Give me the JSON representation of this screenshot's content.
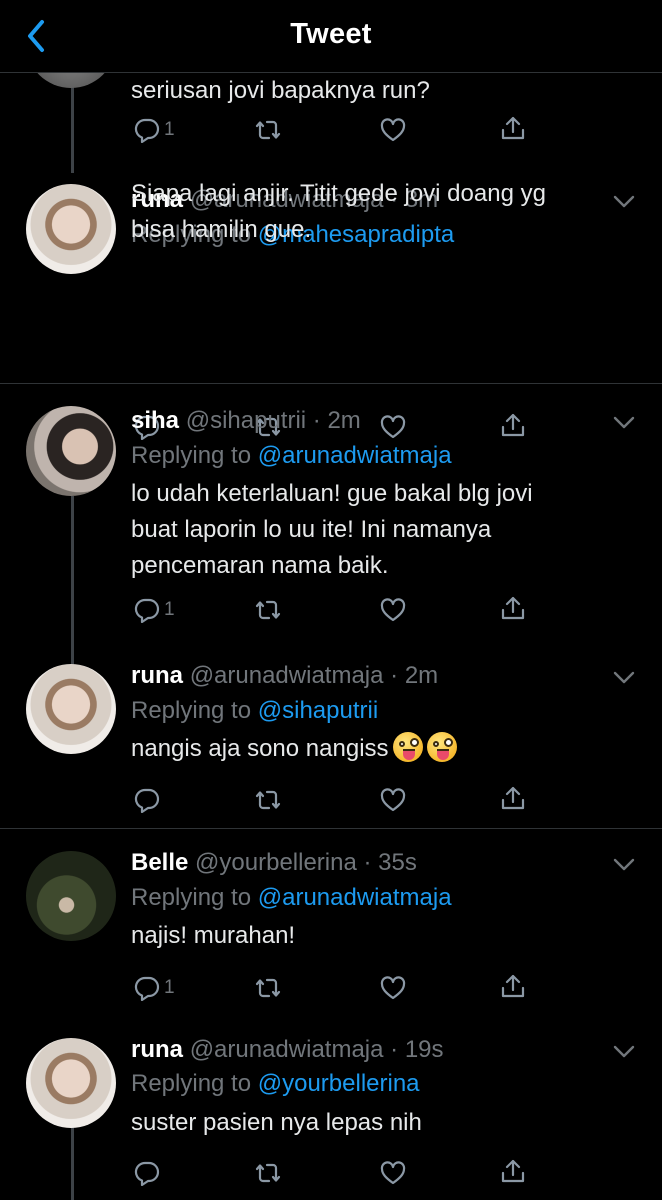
{
  "header": {
    "title": "Tweet"
  },
  "colors": {
    "accent": "#1d9bf0",
    "muted": "#71767b",
    "background": "#000000"
  },
  "tweets": [
    {
      "text": "seriusan jovi bapaknya run?",
      "replies": "1"
    },
    {
      "name": "runa",
      "handle": "@arunadwiatmaja",
      "time": "3m",
      "replying_label": "Replying to",
      "replying_to": "@mahesapradipta",
      "text_lines": [
        "Siapa lagi anjir. Titit gede jovi doang yg",
        "bisa hamilin gue."
      ],
      "replies": ""
    },
    {
      "name": "siha",
      "handle": "@sihaputrii",
      "time": "2m",
      "replying_label": "Replying to",
      "replying_to": "@arunadwiatmaja",
      "text_lines": [
        "lo udah keterlaluan! gue bakal blg jovi",
        "buat laporin lo uu ite! Ini namanya",
        "pencemaran nama baik."
      ],
      "replies": "1"
    },
    {
      "name": "runa",
      "handle": "@arunadwiatmaja",
      "time": "2m",
      "replying_label": "Replying to",
      "replying_to": "@sihaputrii",
      "text": "nangis aja sono nangiss",
      "emojis": [
        "zany-face-emoji",
        "zany-face-emoji"
      ],
      "replies": ""
    },
    {
      "name": "Belle",
      "handle": "@yourbellerina",
      "time": "35s",
      "replying_label": "Replying to",
      "replying_to": "@arunadwiatmaja",
      "text": "najis! murahan!",
      "replies": "1"
    },
    {
      "name": "runa",
      "handle": "@arunadwiatmaja",
      "time": "19s",
      "replying_label": "Replying to",
      "replying_to": "@yourbellerina",
      "text": "suster pasien nya lepas nih",
      "replies": ""
    }
  ],
  "icons": [
    "back-chevron-icon",
    "caret-down-icon",
    "reply-icon",
    "retweet-icon",
    "like-icon",
    "share-icon"
  ]
}
